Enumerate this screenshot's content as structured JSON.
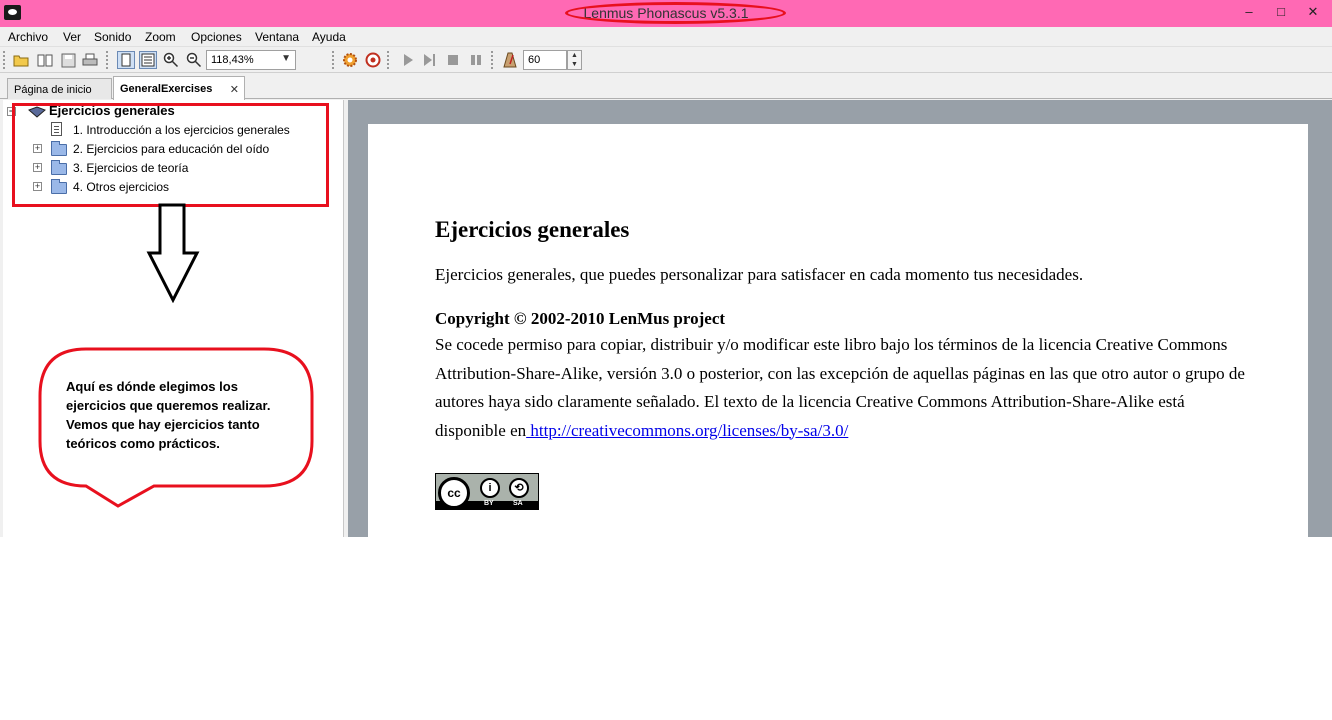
{
  "window": {
    "title": "Lenmus Phonascus v5.3.1",
    "minimize": "–",
    "maximize": "□",
    "close": "✕"
  },
  "menu": [
    "Archivo",
    "Ver",
    "Sonido",
    "Zoom",
    "Opciones",
    "Ventana",
    "Ayuda"
  ],
  "toolbar": {
    "zoom_value": "118,43%",
    "tempo_value": "60",
    "icons": [
      "open-folder-icon",
      "open-book-icon",
      "save-icon",
      "print-icon",
      "page-view-icon",
      "page-layout-icon",
      "zoom-in-icon",
      "zoom-out-icon",
      "gear-icon",
      "settings-wheel-icon",
      "play-icon",
      "play-step-icon",
      "stop-icon",
      "pause-icon",
      "metronome-icon"
    ]
  },
  "tabs": [
    {
      "label": "Página de inicio",
      "active": false
    },
    {
      "label": "GeneralExercises",
      "active": true,
      "close": "✕"
    }
  ],
  "tree": {
    "root": "Ejercicios generales",
    "items": [
      {
        "label": "1. Introducción a los ejercicios generales",
        "icon": "document-icon",
        "expandable": false
      },
      {
        "label": "2. Ejercicios para educación del oído",
        "icon": "folder-icon",
        "expandable": true
      },
      {
        "label": "3. Ejercicios de teoría",
        "icon": "folder-icon",
        "expandable": true
      },
      {
        "label": "4. Otros ejercicios",
        "icon": "folder-icon",
        "expandable": true
      }
    ]
  },
  "annotation": {
    "bubble_lines": [
      "Aquí es dónde elegimos los",
      "ejercicios que queremos realizar.",
      "Vemos que hay ejercicios tanto",
      "teóricos como prácticos."
    ],
    "highlight_color": "#e8101e"
  },
  "content": {
    "title": "Ejercicios generales",
    "intro": "Ejercicios generales, que puedes personalizar para satisfacer en cada momento tus necesidades.",
    "copyright_heading": "Copyright © 2002-2010 LenMus project",
    "license_text": "Se cocede permiso para copiar, distribuir y/o modificar este libro bajo los términos de la licencia Creative Commons Attribution-Share-Alike, versión 3.0 o posterior, con las excepción de aquellas páginas en las que otro autor o grupo de autores haya sido claramente señalado. El texto de la licencia Creative Commons Attribution-Share-Alike está disponible en",
    "license_link": " http://creativecommons.org/licenses/by-sa/3.0/",
    "badge": {
      "cc": "cc",
      "by_icon": "i",
      "sa_icon": "⟲",
      "by": "BY",
      "sa": "SA"
    }
  },
  "colors": {
    "titlebar": "#ff69b4",
    "annotation_red": "#e8101e",
    "link": "#0000e8",
    "content_bg": "#98a0a8"
  }
}
